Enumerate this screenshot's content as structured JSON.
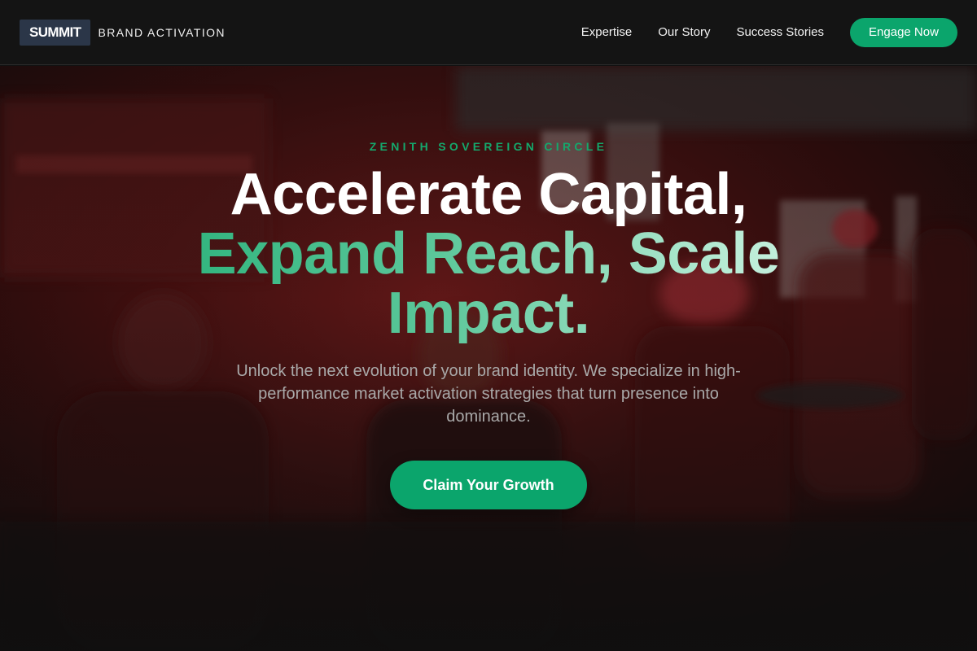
{
  "header": {
    "logo_text": "SUMMIT",
    "brand_tagline": "BRAND ACTIVATION",
    "nav": [
      {
        "label": "Expertise"
      },
      {
        "label": "Our Story"
      },
      {
        "label": "Success Stories"
      }
    ],
    "cta_label": "Engage Now"
  },
  "hero": {
    "eyebrow": "ZENITH SOVEREIGN CIRCLE",
    "headline": {
      "line1": "Accelerate Capital,",
      "line2": "Expand Reach, Scale",
      "line3": "Impact."
    },
    "subtext": "Unlock the next evolution of your brand identity. We specialize in high-performance market activation strategies that turn presence into dominance.",
    "cta_label": "Claim Your Growth",
    "background_image": "nightlife-party-crowd-red-lighting"
  },
  "colors": {
    "accent": "#0ba56c",
    "header_bg": "#141414",
    "logo_bg": "#2b3648",
    "subtext": "#a9a9a9",
    "hero_tint": "#6e1414"
  }
}
